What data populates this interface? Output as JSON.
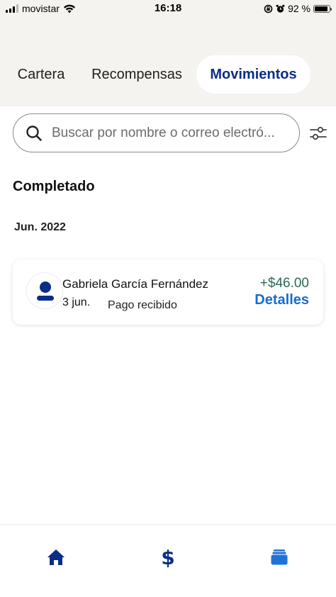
{
  "status_bar": {
    "carrier": "movistar",
    "time": "16:18",
    "battery_percent": "92 %",
    "battery_level": 0.92,
    "icons": [
      "signal-icon",
      "wifi-icon",
      "lock-rotation-icon",
      "alarm-icon",
      "battery-icon"
    ]
  },
  "tabs": [
    {
      "label": "Cartera",
      "active": false
    },
    {
      "label": "Recompensas",
      "active": false
    },
    {
      "label": "Movimientos",
      "active": true
    }
  ],
  "search": {
    "placeholder": "Buscar por nombre o correo electró...",
    "icon": "search-icon",
    "filter_icon": "filter-sliders-icon"
  },
  "section_title": "Completado",
  "groups": [
    {
      "month": "Jun. 2022",
      "transactions": [
        {
          "name": "Gabriela García Fernández",
          "date": "3 jun.",
          "description": "Pago recibido",
          "amount": "+$46.00",
          "details_label": "Detalles",
          "avatar_icon": "person-icon"
        }
      ]
    }
  ],
  "bottom_nav": [
    {
      "icon": "home-icon"
    },
    {
      "icon": "dollar-icon",
      "glyph": "$"
    },
    {
      "icon": "wallet-cards-icon"
    }
  ],
  "colors": {
    "brand_navy": "#0b2e86",
    "link_blue": "#1a6ec7",
    "amount_green": "#2a6a52",
    "header_bg": "#f4f3ef"
  }
}
